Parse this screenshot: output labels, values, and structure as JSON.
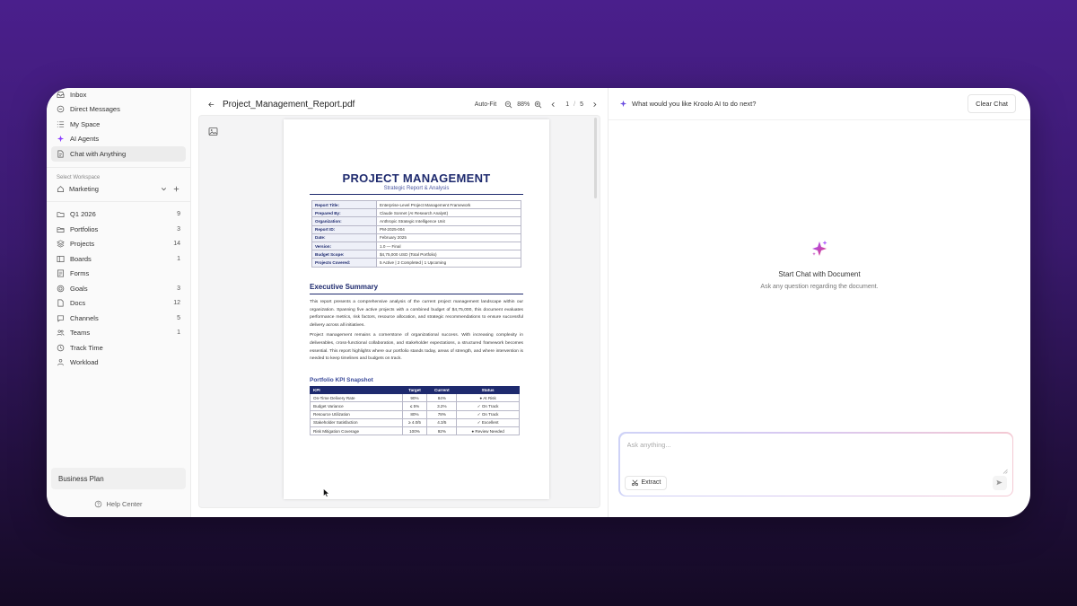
{
  "sidebar": {
    "items": [
      {
        "label": "Inbox",
        "icon": "inbox-icon"
      },
      {
        "label": "Direct Messages",
        "icon": "message-icon"
      },
      {
        "label": "My Space",
        "icon": "list-icon"
      },
      {
        "label": "AI Agents",
        "icon": "sparkle-icon"
      },
      {
        "label": "Chat with Anything",
        "icon": "document-chat-icon"
      }
    ],
    "active_item": "Chat with Anything",
    "workspace_label": "Select Workspace",
    "workspace_value": "Marketing",
    "workspace_items": [
      {
        "label": "Q1 2026",
        "count": "9"
      },
      {
        "label": "Portfolios",
        "count": "3"
      },
      {
        "label": "Projects",
        "count": "14"
      },
      {
        "label": "Boards",
        "count": "1"
      },
      {
        "label": "Forms",
        "count": ""
      },
      {
        "label": "Goals",
        "count": "3"
      },
      {
        "label": "Docs",
        "count": "12"
      },
      {
        "label": "Channels",
        "count": "5"
      },
      {
        "label": "Teams",
        "count": "1"
      },
      {
        "label": "Track Time",
        "count": ""
      },
      {
        "label": "Workload",
        "count": ""
      }
    ],
    "business_plan": "Business Plan",
    "help_center": "Help Center"
  },
  "document": {
    "file_name": "Project_Management_Report.pdf",
    "fit_mode": "Auto-Fit",
    "zoom": "88%",
    "page_current": "1",
    "page_separator": "/",
    "page_total": "5",
    "page": {
      "title": "PROJECT MANAGEMENT",
      "subtitle": "Strategic Report & Analysis",
      "info_rows": [
        {
          "key": "Report Title:",
          "value": "Enterprise-Level Project Management Framework"
        },
        {
          "key": "Prepared By:",
          "value": "Claude Sonnet (AI Research Analyst)"
        },
        {
          "key": "Organization:",
          "value": "Anthropic Strategic Intelligence Unit"
        },
        {
          "key": "Report ID:",
          "value": "PM-2025-004"
        },
        {
          "key": "Date:",
          "value": "February 2025"
        },
        {
          "key": "Version:",
          "value": "1.0 — Final"
        },
        {
          "key": "Budget Scope:",
          "value": "$4,75,000 USD (Total Portfolio)"
        },
        {
          "key": "Projects Covered:",
          "value": "5 Active | 2 Completed | 1 Upcoming"
        }
      ],
      "exec_heading": "Executive Summary",
      "exec_para1": "This report presents a comprehensive analysis of the current project management landscape within our organization. Spanning five active projects with a combined budget of $4,75,000, this document evaluates performance metrics, risk factors, resource allocation, and strategic recommendations to ensure successful delivery across all initiatives.",
      "exec_para2": "Project management remains a cornerstone of organizational success. With increasing complexity in deliverables, cross-functional collaboration, and stakeholder expectations, a structured framework becomes essential. This report highlights where our portfolio stands today, areas of strength, and where intervention is needed to keep timelines and budgets on track.",
      "kpi_heading": "Portfolio KPI Snapshot",
      "kpi_columns": [
        "KPI",
        "Target",
        "Current",
        "Status"
      ],
      "kpi_rows": [
        [
          "On-Time Delivery Rate",
          "90%",
          "84%",
          "● At Risk"
        ],
        [
          "Budget Variance",
          "≤ 5%",
          "3.2%",
          "✓ On Track"
        ],
        [
          "Resource Utilization",
          "80%",
          "78%",
          "✓ On Track"
        ],
        [
          "Stakeholder Satisfaction",
          "≥ 4.0/5",
          "4.3/5",
          "✓ Excellent"
        ],
        [
          "Risk Mitigation Coverage",
          "100%",
          "92%",
          "● Review Needed"
        ]
      ]
    }
  },
  "chat": {
    "prompt": "What would you like Kroolo AI to do next?",
    "clear_label": "Clear Chat",
    "empty_title": "Start Chat with Document",
    "empty_subtitle": "Ask any question regarding the document.",
    "input_placeholder": "Ask anything...",
    "extract_label": "Extract"
  },
  "colors": {
    "background_top": "#4a1f8c",
    "doc_navy": "#1e2a6e",
    "sparkle_purple": "#8b3dff"
  }
}
